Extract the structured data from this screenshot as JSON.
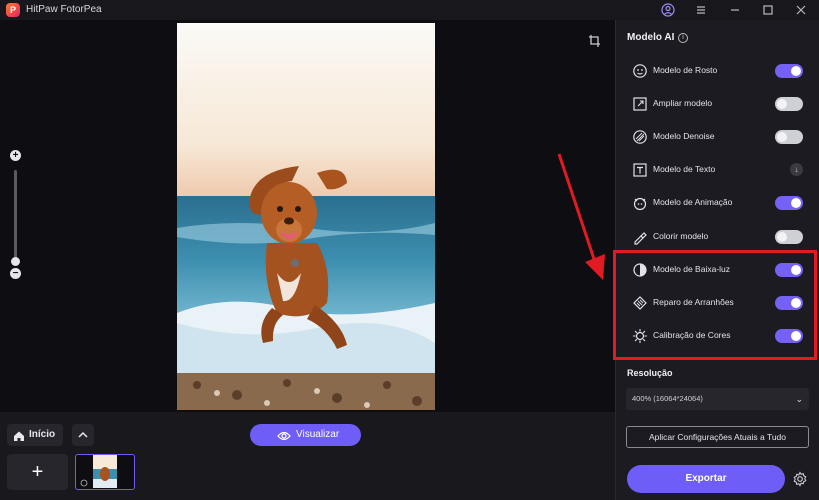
{
  "app": {
    "title": "HitPaw FotorPea",
    "logo_letter": "P"
  },
  "window_controls": {
    "account": "account-icon",
    "menu": "menu-icon",
    "minimize": "minimize-icon",
    "maximize": "maximize-icon",
    "close": "close-icon"
  },
  "canvas": {
    "zoom_level_fraction": 0.1
  },
  "bottom_bar": {
    "home_label": "Início",
    "preview_label": "Visualizar",
    "add_label": "+"
  },
  "panel": {
    "title": "Modelo AI",
    "models": [
      {
        "label": "Modelo de Rosto",
        "icon": "face-icon",
        "state": "on"
      },
      {
        "label": "Ampliar modelo",
        "icon": "upscale-icon",
        "state": "off"
      },
      {
        "label": "Modelo Denoise",
        "icon": "denoise-icon",
        "state": "off"
      },
      {
        "label": "Modelo de Texto",
        "icon": "text-icon",
        "state": "download"
      },
      {
        "label": "Modelo de Animação",
        "icon": "animation-icon",
        "state": "on"
      },
      {
        "label": "Colorir modelo",
        "icon": "colorize-icon",
        "state": "off"
      },
      {
        "label": "Modelo de Baixa-luz",
        "icon": "low-light-icon",
        "state": "on"
      },
      {
        "label": "Reparo de Arranhões",
        "icon": "scratch-repair-icon",
        "state": "on"
      },
      {
        "label": "Calibração de Cores",
        "icon": "color-calibration-icon",
        "state": "on"
      }
    ],
    "resolution_title": "Resolução",
    "resolution_value": "400% (16064*24064)",
    "apply_label": "Aplicar Configurações Atuais a Tudo",
    "export_label": "Exportar"
  },
  "colors": {
    "accent": "#6e5df6",
    "highlight": "#e01b24",
    "toggle_on": "#7561f5"
  }
}
